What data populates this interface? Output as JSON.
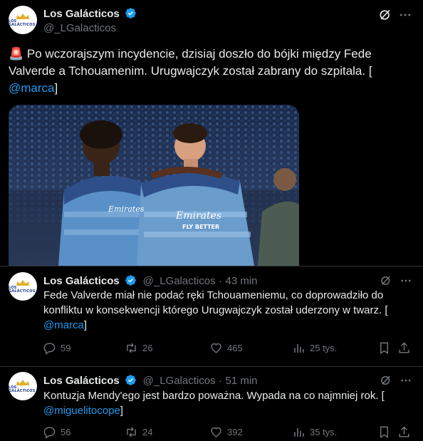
{
  "main_tweet": {
    "name": "Los Galácticos",
    "handle": "@_LGalacticos",
    "emoji": "🚨",
    "text": "Po wczorajszym incydencie, dzisiaj doszło do bójki między Fede Valverde a Tchouamenim. Urugwajczyk został zabrany do szpitala. [",
    "mention": "@marca",
    "suffix": "]",
    "image_alt": "Two Real Madrid players in blue training kits",
    "jersey_text_1": "Emirates",
    "jersey_text_2": "Emirates",
    "jersey_text_3": "FLY BETTER"
  },
  "replies": [
    {
      "name": "Los Galácticos",
      "handle": "@_LGalacticos",
      "sep": "·",
      "time": "43 min",
      "text": "Fede Valverde miał nie podać ręki Tchouameniemu, co doprowadziło do konfliktu w konsekwencji którego Urugwajczyk został uderzony w twarz. [",
      "mention": "@marca",
      "suffix": "]",
      "replies": "59",
      "reposts": "26",
      "likes": "465",
      "views": "25 tys."
    },
    {
      "name": "Los Galácticos",
      "handle": "@_LGalacticos",
      "sep": "·",
      "time": "51 min",
      "text": "Kontuzja Mendy'ego jest bardzo poważna. Wypada na co najmniej rok. [",
      "mention": "@miguelitocope",
      "suffix": "]",
      "replies": "56",
      "reposts": "24",
      "likes": "392",
      "views": "35 tys."
    }
  ],
  "avatar_text": "LOS GALÁCTICOS",
  "colors": {
    "accent": "#1d9bf0",
    "muted": "#71767b",
    "text": "#e7e9ea",
    "bg": "#000000"
  }
}
